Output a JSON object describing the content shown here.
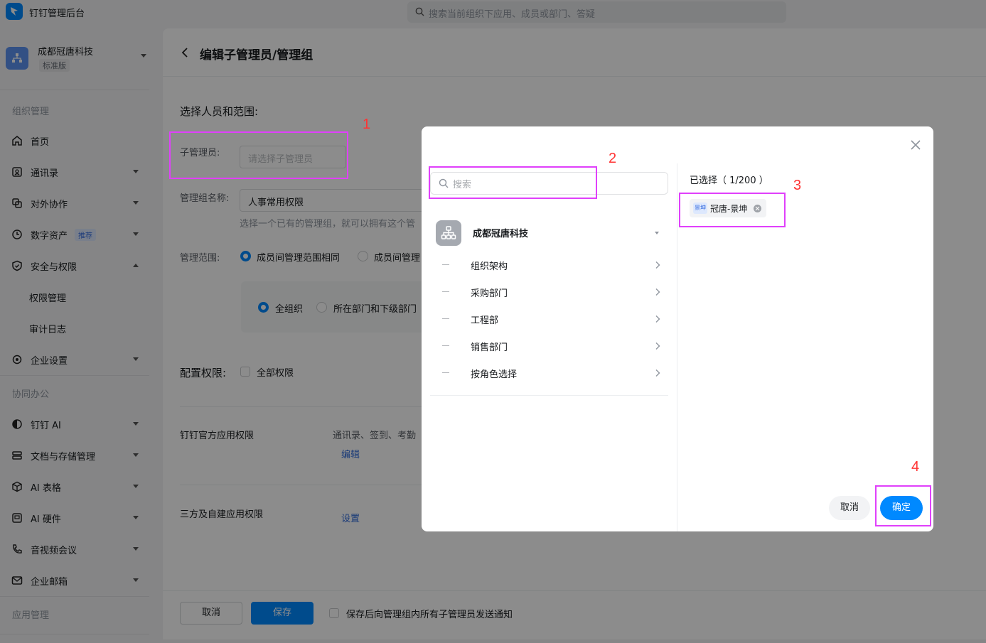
{
  "app": {
    "title": "钉钉管理后台",
    "search_placeholder": "搜索当前组织下应用、成员或部门、答疑"
  },
  "org": {
    "name": "成都冠唐科技",
    "edition": "标准版"
  },
  "sidebar": {
    "section_org": "组织管理",
    "section_collab": "协同办公",
    "section_app": "应用管理",
    "items": [
      {
        "label": "首页"
      },
      {
        "label": "通讯录"
      },
      {
        "label": "对外协作"
      },
      {
        "label": "数字资产",
        "tag": "推荐"
      },
      {
        "label": "安全与权限"
      },
      {
        "label": "企业设置"
      },
      {
        "label": "钉钉 AI"
      },
      {
        "label": "文档与存储管理"
      },
      {
        "label": "AI 表格"
      },
      {
        "label": "AI 硬件"
      },
      {
        "label": "音视频会议"
      },
      {
        "label": "企业邮箱"
      }
    ],
    "sub_items": [
      {
        "label": "权限管理"
      },
      {
        "label": "审计日志"
      }
    ]
  },
  "page": {
    "title": "编辑子管理员/管理组",
    "section_select": "选择人员和范围:",
    "label_admin": "子管理员:",
    "admin_placeholder": "请选择子管理员",
    "label_group_name": "管理组名称:",
    "group_name_value": "人事常用权限",
    "group_hint": "选择一个已有的管理组，就可以拥有这个管",
    "label_scope": "管理范围:",
    "scope_option_1": "成员间管理范围相同",
    "scope_option_2": "成员间管理",
    "sub_option_1": "全组织",
    "sub_option_2": "所在部门和下级部门",
    "section_perm": "配置权限:",
    "perm_all": "全部权限",
    "official_perm_label": "钉钉官方应用权限",
    "official_perm_desc": "通讯录、签到、考勤",
    "official_perm_link": "编辑",
    "third_perm_label": "三方及自建应用权限",
    "third_perm_link": "设置"
  },
  "footer": {
    "cancel": "取消",
    "save": "保存",
    "notify": "保存后向管理组内所有子管理员发送通知"
  },
  "modal": {
    "search_placeholder": "搜索",
    "org_name": "成都冠唐科技",
    "departments": [
      {
        "label": "组织架构"
      },
      {
        "label": "采购部门"
      },
      {
        "label": "工程部"
      },
      {
        "label": "销售部门"
      },
      {
        "label": "按角色选择"
      }
    ],
    "selected_title": "已选择（ 1/200 ）",
    "selected": [
      {
        "avatar_text": "景坤",
        "label": "冠唐-景坤"
      }
    ],
    "cancel": "取消",
    "confirm": "确定"
  },
  "annotations": {
    "n1": "1",
    "n2": "2",
    "n3": "3",
    "n4": "4",
    "box_color": "#e040fb",
    "number_color": "#ff3333"
  },
  "colors": {
    "accent": "#0089ff",
    "link": "#2f6bda"
  }
}
